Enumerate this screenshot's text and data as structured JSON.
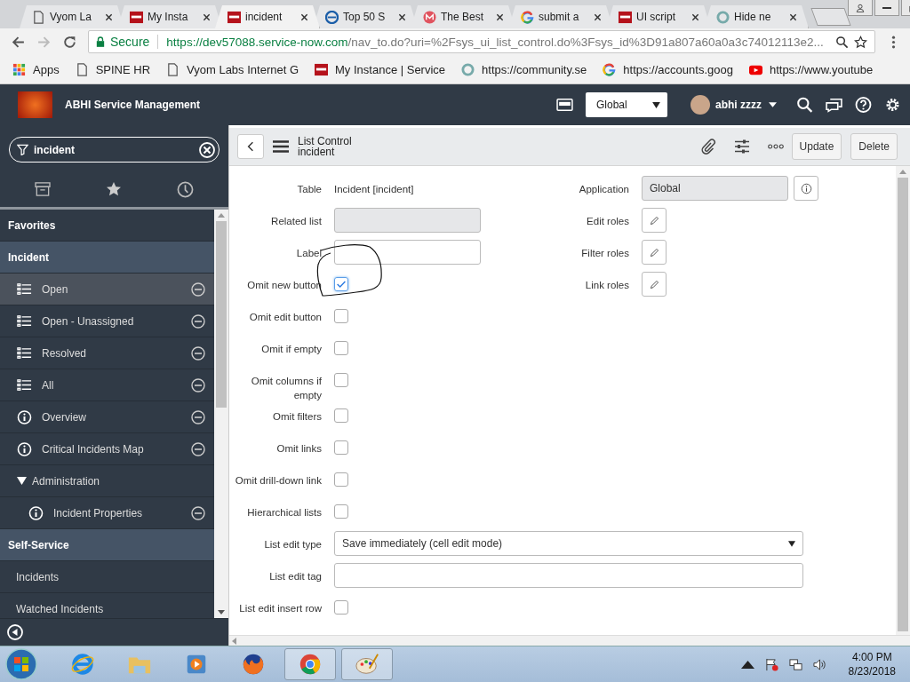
{
  "browser": {
    "tabs": [
      {
        "title": "Vyom La",
        "kind": "page",
        "selected": false
      },
      {
        "title": "My Insta",
        "kind": "now",
        "selected": false
      },
      {
        "title": "incident",
        "kind": "now",
        "selected": true
      },
      {
        "title": "Top 50 S",
        "kind": "e",
        "selected": false
      },
      {
        "title": "The Best",
        "kind": "mail",
        "selected": false
      },
      {
        "title": "submit a",
        "kind": "google",
        "selected": false
      },
      {
        "title": "UI script",
        "kind": "now",
        "selected": false
      },
      {
        "title": "Hide ne",
        "kind": "ring",
        "selected": false
      }
    ],
    "forward_disabled": true,
    "secure_label": "Secure",
    "url_host": "https://dev57088.service-now.com",
    "url_path": "/nav_to.do?uri=%2Fsys_ui_list_control.do%3Fsys_id%3D91a807a60a0a3c74012113e2...",
    "bookmarks": [
      {
        "label": "Apps",
        "kind": "apps"
      },
      {
        "label": "SPINE HR",
        "kind": "page"
      },
      {
        "label": "Vyom Labs Internet G",
        "kind": "page"
      },
      {
        "label": "My Instance | Service",
        "kind": "now"
      },
      {
        "label": "https://community.se",
        "kind": "ring"
      },
      {
        "label": "https://accounts.goog",
        "kind": "google"
      },
      {
        "label": "https://www.youtube",
        "kind": "youtube"
      }
    ]
  },
  "header": {
    "title": "ABHI Service Management",
    "scope": "Global",
    "user": "abhi zzzz"
  },
  "sidebar": {
    "filter": "incident",
    "items": [
      {
        "kind": "section",
        "label": "Favorites",
        "highlighted": false
      },
      {
        "kind": "section",
        "label": "Incident",
        "highlighted": true
      },
      {
        "kind": "list",
        "label": "Open",
        "selected": true
      },
      {
        "kind": "list",
        "label": "Open - Unassigned",
        "selected": false
      },
      {
        "kind": "list",
        "label": "Resolved",
        "selected": false
      },
      {
        "kind": "list",
        "label": "All",
        "selected": false
      },
      {
        "kind": "info",
        "label": "Overview",
        "selected": false
      },
      {
        "kind": "info",
        "label": "Critical Incidents Map",
        "selected": false
      },
      {
        "kind": "folder",
        "label": "Administration",
        "expanded": true,
        "children": [
          {
            "kind": "info",
            "label": "Incident Properties",
            "selected": false
          }
        ]
      },
      {
        "kind": "section",
        "label": "Self-Service",
        "highlighted": true
      },
      {
        "kind": "link",
        "label": "Incidents"
      },
      {
        "kind": "link",
        "label": "Watched Incidents"
      }
    ]
  },
  "form": {
    "title": "List Control",
    "subtitle": "incident",
    "buttons": [
      "Update",
      "Delete"
    ],
    "left": [
      {
        "kind": "text",
        "label": "Table",
        "value": "Incident [incident]"
      },
      {
        "kind": "readonly",
        "label": "Related list"
      },
      {
        "kind": "input",
        "label": "Label"
      },
      {
        "kind": "checkbox",
        "label": "Omit new button",
        "checked": true
      },
      {
        "kind": "checkbox",
        "label": "Omit edit button",
        "checked": false
      },
      {
        "kind": "checkbox",
        "label": "Omit if empty",
        "checked": false
      },
      {
        "kind": "checkbox",
        "label": "Omit columns if empty",
        "checked": false
      },
      {
        "kind": "checkbox",
        "label": "Omit filters",
        "checked": false
      },
      {
        "kind": "checkbox",
        "label": "Omit links",
        "checked": false
      },
      {
        "kind": "checkbox",
        "label": "Omit drill-down link",
        "checked": false
      },
      {
        "kind": "checkbox",
        "label": "Hierarchical lists",
        "checked": false
      }
    ],
    "right": [
      {
        "kind": "readonly",
        "label": "Application",
        "value": "Global"
      },
      {
        "kind": "roles",
        "label": "Edit roles"
      },
      {
        "kind": "roles",
        "label": "Filter roles"
      },
      {
        "kind": "roles",
        "label": "Link roles"
      }
    ],
    "wide": [
      {
        "kind": "select",
        "label": "List edit type",
        "value": "Save immediately (cell edit mode)"
      },
      {
        "kind": "input",
        "label": "List edit tag"
      },
      {
        "kind": "checkbox",
        "label": "List edit insert row",
        "checked": false
      }
    ]
  },
  "taskbar": {
    "apps": [
      {
        "kind": "ie",
        "active": false
      },
      {
        "kind": "folder",
        "active": false
      },
      {
        "kind": "media",
        "active": false
      },
      {
        "kind": "firefox",
        "active": false
      },
      {
        "kind": "chrome",
        "active": true
      },
      {
        "kind": "paint",
        "active": true
      }
    ],
    "time": "4:00 PM",
    "date": "8/23/2018"
  }
}
